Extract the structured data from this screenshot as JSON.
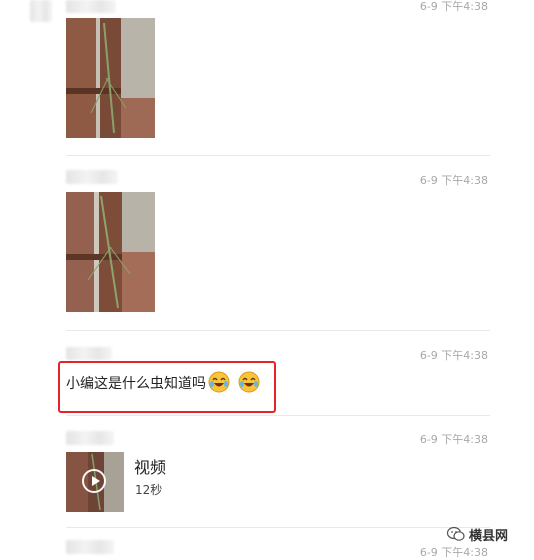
{
  "messages": [
    {
      "type": "image",
      "time": "6-9 下午4:38"
    },
    {
      "type": "image",
      "time": "6-9 下午4:38"
    },
    {
      "type": "text",
      "time": "6-9 下午4:38",
      "text": "小编这是什么虫知道吗",
      "emojis": [
        "laugh-cry-emoji",
        "laugh-cry-emoji"
      ]
    },
    {
      "type": "video",
      "time": "6-9 下午4:38",
      "title": "视频",
      "duration": "12秒"
    },
    {
      "type": "partial",
      "time": "6-9 下午4:38"
    }
  ],
  "watermark": {
    "text": "横县网"
  },
  "colors": {
    "highlight": "#e0262a",
    "timestamp": "#a8a8a8",
    "divider": "#e9e9e9"
  }
}
